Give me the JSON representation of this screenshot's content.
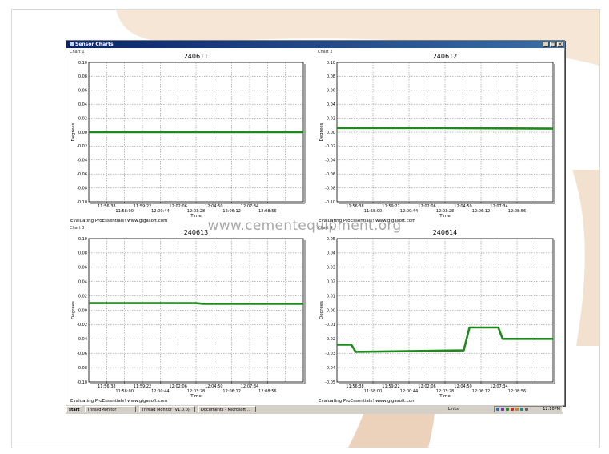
{
  "window": {
    "title": "Sensor Charts"
  },
  "watermark": "www.cementequipment.org",
  "panels": [
    {
      "label": "Chart 1",
      "footer": "Evaluating ProEssentials! www.gigasoft.com"
    },
    {
      "label": "Chart 2",
      "footer": "Evaluating ProEssentials! www.gigasoft.com"
    },
    {
      "label": "Chart 3",
      "footer": "Evaluating ProEssentials! www.gigasoft.com"
    },
    {
      "label": "Chart 4",
      "footer": "Evaluating ProEssentials! www.gigasoft.com"
    }
  ],
  "taskbar": {
    "start": "start",
    "items": [
      "ThreadMonitor",
      "Thread Monitor (V1.0.0)",
      "Documents - Microsoft ..."
    ],
    "links": "Links",
    "clock": "12:10PM"
  },
  "colors": {
    "series": "#1e8a1e",
    "titlebar": "#0a246a",
    "panel_bg": "#d4d0c8"
  },
  "chart_data": [
    {
      "type": "line",
      "title": "240611",
      "xlabel": "Time",
      "ylabel": "Degrees",
      "ylim": [
        -0.1,
        0.1
      ],
      "yticks": [
        "0.10",
        "0.08",
        "0.06",
        "0.04",
        "0.02",
        "0.00",
        "-0.02",
        "-0.04",
        "-0.06",
        "-0.08",
        "-0.10"
      ],
      "xticks_top": [
        "11:56:38",
        "11:59:22",
        "12:02:06",
        "12:04:50",
        "12:07:34"
      ],
      "xticks_bottom": [
        "11:58:00",
        "12:00:44",
        "12:03:28",
        "12:06:12",
        "12:08:56"
      ],
      "xlim": [
        0,
        15
      ],
      "grid": true,
      "series": [
        {
          "x": [
            0,
            15
          ],
          "y": [
            0.0,
            0.0
          ]
        }
      ]
    },
    {
      "type": "line",
      "title": "240612",
      "xlabel": "Time",
      "ylabel": "Degrees",
      "ylim": [
        -0.1,
        0.1
      ],
      "yticks": [
        "0.10",
        "0.08",
        "0.06",
        "0.04",
        "0.02",
        "0.00",
        "-0.02",
        "-0.04",
        "-0.06",
        "-0.08",
        "-0.10"
      ],
      "xticks_top": [
        "11:56:38",
        "11:59:22",
        "12:02:06",
        "12:04:50",
        "12:07:34"
      ],
      "xticks_bottom": [
        "11:58:00",
        "12:00:44",
        "12:03:28",
        "12:06:12",
        "12:08:56"
      ],
      "xlim": [
        0,
        15
      ],
      "grid": true,
      "series": [
        {
          "x": [
            0,
            7,
            15
          ],
          "y": [
            0.006,
            0.006,
            0.005
          ]
        }
      ]
    },
    {
      "type": "line",
      "title": "240613",
      "xlabel": "Time",
      "ylabel": "Degrees",
      "ylim": [
        -0.1,
        0.1
      ],
      "yticks": [
        "0.10",
        "0.08",
        "0.06",
        "0.04",
        "0.02",
        "0.00",
        "-0.02",
        "-0.04",
        "-0.06",
        "-0.08",
        "-0.10"
      ],
      "xticks_top": [
        "11:56:38",
        "11:59:22",
        "12:02:06",
        "12:04:50",
        "12:07:34"
      ],
      "xticks_bottom": [
        "11:58:00",
        "12:00:44",
        "12:03:28",
        "12:06:12",
        "12:08:56"
      ],
      "xlim": [
        0,
        15
      ],
      "grid": true,
      "series": [
        {
          "x": [
            0,
            7.5,
            8,
            15
          ],
          "y": [
            0.01,
            0.01,
            0.009,
            0.009
          ]
        }
      ]
    },
    {
      "type": "line",
      "title": "240614",
      "xlabel": "Time",
      "ylabel": "Degrees",
      "ylim": [
        -0.05,
        0.05
      ],
      "yticks": [
        "0.05",
        "0.04",
        "0.03",
        "0.02",
        "0.01",
        "0.00",
        "-0.01",
        "-0.02",
        "-0.03",
        "-0.04",
        "-0.05"
      ],
      "xticks_top": [
        "11:56:38",
        "11:59:22",
        "12:02:06",
        "12:04:50",
        "12:07:34"
      ],
      "xticks_bottom": [
        "11:58:00",
        "12:00:44",
        "12:03:28",
        "12:06:12",
        "12:08:56"
      ],
      "xlim": [
        0,
        15
      ],
      "grid": true,
      "series": [
        {
          "x": [
            0,
            1.0,
            1.3,
            8.8,
            9.2,
            11.2,
            11.5,
            15
          ],
          "y": [
            -0.024,
            -0.024,
            -0.029,
            -0.028,
            -0.012,
            -0.012,
            -0.02,
            -0.02
          ]
        }
      ]
    }
  ]
}
